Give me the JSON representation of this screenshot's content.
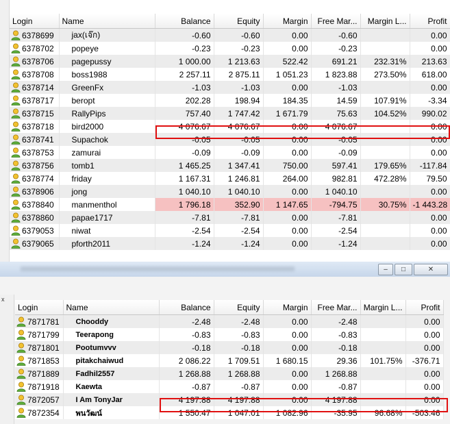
{
  "top": {
    "columns": [
      "Login",
      "Name",
      "Balance",
      "Equity",
      "Margin",
      "Free Mar...",
      "Margin L...",
      "Profit"
    ],
    "rows": [
      {
        "login": "6378699",
        "name": "jax(เจ๊ก)",
        "balance": "-0.60",
        "equity": "-0.60",
        "margin": "0.00",
        "free": "-0.60",
        "ml": "",
        "profit": "0.00"
      },
      {
        "login": "6378702",
        "name": "popeye",
        "balance": "-0.23",
        "equity": "-0.23",
        "margin": "0.00",
        "free": "-0.23",
        "ml": "",
        "profit": "0.00"
      },
      {
        "login": "6378706",
        "name": "pagepussy",
        "balance": "1 000.00",
        "equity": "1 213.63",
        "margin": "522.42",
        "free": "691.21",
        "ml": "232.31%",
        "profit": "213.63"
      },
      {
        "login": "6378708",
        "name": "boss1988",
        "balance": "2 257.11",
        "equity": "2 875.11",
        "margin": "1 051.23",
        "free": "1 823.88",
        "ml": "273.50%",
        "profit": "618.00"
      },
      {
        "login": "6378714",
        "name": "GreenFx",
        "balance": "-1.03",
        "equity": "-1.03",
        "margin": "0.00",
        "free": "-1.03",
        "ml": "",
        "profit": "0.00"
      },
      {
        "login": "6378717",
        "name": "beropt",
        "balance": "202.28",
        "equity": "198.94",
        "margin": "184.35",
        "free": "14.59",
        "ml": "107.91%",
        "profit": "-3.34"
      },
      {
        "login": "6378715",
        "name": "RallyPips",
        "balance": "757.40",
        "equity": "1 747.42",
        "margin": "1 671.79",
        "free": "75.63",
        "ml": "104.52%",
        "profit": "990.02"
      },
      {
        "login": "6378718",
        "name": "bird2000",
        "balance": "4 076.67",
        "equity": "4 076.67",
        "margin": "0.00",
        "free": "4 076.67",
        "ml": "",
        "profit": "0.00"
      },
      {
        "login": "6378741",
        "name": "Supachok",
        "balance": "-0.05",
        "equity": "-0.05",
        "margin": "0.00",
        "free": "-0.05",
        "ml": "",
        "profit": "0.00"
      },
      {
        "login": "6378753",
        "name": "zamurai",
        "balance": "-0.09",
        "equity": "-0.09",
        "margin": "0.00",
        "free": "-0.09",
        "ml": "",
        "profit": "0.00"
      },
      {
        "login": "6378756",
        "name": "tomb1",
        "balance": "1 465.25",
        "equity": "1 347.41",
        "margin": "750.00",
        "free": "597.41",
        "ml": "179.65%",
        "profit": "-117.84"
      },
      {
        "login": "6378774",
        "name": "friday",
        "balance": "1 167.31",
        "equity": "1 246.81",
        "margin": "264.00",
        "free": "982.81",
        "ml": "472.28%",
        "profit": "79.50"
      },
      {
        "login": "6378906",
        "name": "jong",
        "balance": "1 040.10",
        "equity": "1 040.10",
        "margin": "0.00",
        "free": "1 040.10",
        "ml": "",
        "profit": "0.00"
      },
      {
        "login": "6378840",
        "name": "manmenthol",
        "balance": "1 796.18",
        "equity": "352.90",
        "margin": "1 147.65",
        "free": "-794.75",
        "ml": "30.75%",
        "profit": "-1 443.28"
      },
      {
        "login": "6378860",
        "name": "papae1717",
        "balance": "-7.81",
        "equity": "-7.81",
        "margin": "0.00",
        "free": "-7.81",
        "ml": "",
        "profit": "0.00"
      },
      {
        "login": "6379053",
        "name": "niwat",
        "balance": "-2.54",
        "equity": "-2.54",
        "margin": "0.00",
        "free": "-2.54",
        "ml": "",
        "profit": "0.00"
      },
      {
        "login": "6379065",
        "name": "pforth2011",
        "balance": "-1.24",
        "equity": "-1.24",
        "margin": "0.00",
        "free": "-1.24",
        "ml": "",
        "profit": "0.00"
      }
    ]
  },
  "bottom": {
    "window_buttons": {
      "minimize": "–",
      "maximize": "□",
      "close": "✕"
    },
    "close_x": "x",
    "columns": [
      "Login",
      "Name",
      "Balance",
      "Equity",
      "Margin",
      "Free Mar...",
      "Margin L...",
      "Profit"
    ],
    "rows": [
      {
        "login": "7871781",
        "name": "Chooddy",
        "balance": "-2.48",
        "equity": "-2.48",
        "margin": "0.00",
        "free": "-2.48",
        "ml": "",
        "profit": "0.00"
      },
      {
        "login": "7871799",
        "name": "Teerapong",
        "balance": "-0.83",
        "equity": "-0.83",
        "margin": "0.00",
        "free": "-0.83",
        "ml": "",
        "profit": "0.00"
      },
      {
        "login": "7871801",
        "name": "Pootumvvv",
        "balance": "-0.18",
        "equity": "-0.18",
        "margin": "0.00",
        "free": "-0.18",
        "ml": "",
        "profit": "0.00"
      },
      {
        "login": "7871853",
        "name": "pitakchaiwud",
        "balance": "2 086.22",
        "equity": "1 709.51",
        "margin": "1 680.15",
        "free": "29.36",
        "ml": "101.75%",
        "profit": "-376.71"
      },
      {
        "login": "7871889",
        "name": "Fadhil2557",
        "balance": "1 268.88",
        "equity": "1 268.88",
        "margin": "0.00",
        "free": "1 268.88",
        "ml": "",
        "profit": "0.00"
      },
      {
        "login": "7871918",
        "name": "Kaewta",
        "balance": "-0.87",
        "equity": "-0.87",
        "margin": "0.00",
        "free": "-0.87",
        "ml": "",
        "profit": "0.00"
      },
      {
        "login": "7872057",
        "name": "I Am TonyJar",
        "balance": "4 197.88",
        "equity": "4 197.88",
        "margin": "0.00",
        "free": "4 197.88",
        "ml": "",
        "profit": "0.00"
      },
      {
        "login": "7872354",
        "name": "พนวัฒน์",
        "balance": "1 550.47",
        "equity": "1 047.01",
        "margin": "1 082.96",
        "free": "-35.95",
        "ml": "96.68%",
        "profit": "-503.46"
      }
    ]
  }
}
